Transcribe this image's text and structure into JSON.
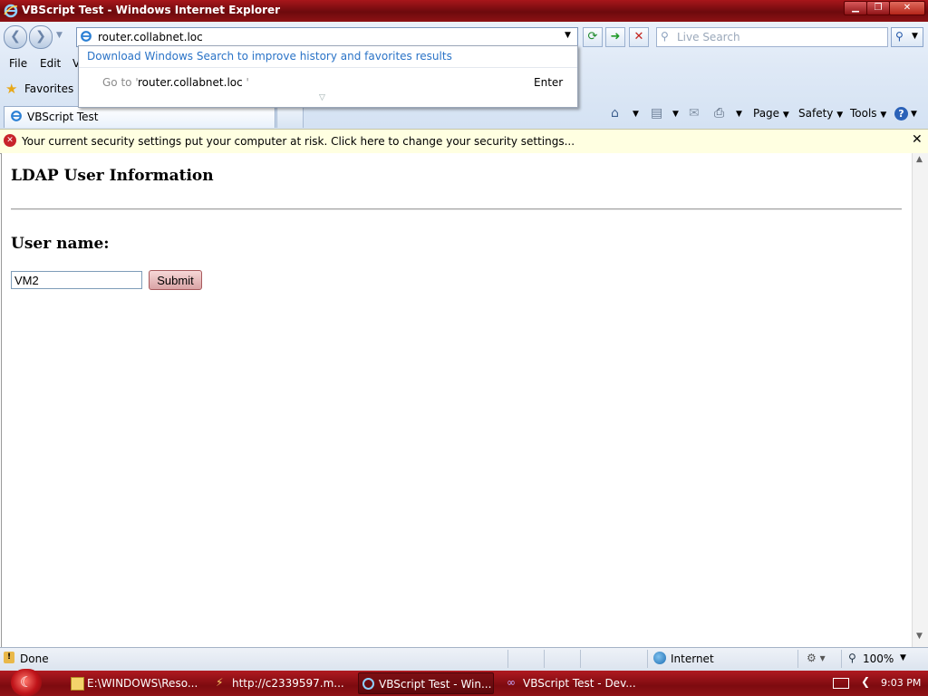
{
  "window": {
    "title": "VBScript Test - Windows Internet Explorer"
  },
  "address": {
    "url": "router.collabnet.loc"
  },
  "search": {
    "placeholder": "Live Search"
  },
  "menu": [
    "File",
    "Edit",
    "V"
  ],
  "favorites": {
    "label": "Favorites"
  },
  "autocomplete": {
    "link": "Download Windows Search to improve history and favorites results",
    "goto_prefix": "Go to ' ",
    "goto_url": "router.collabnet.loc",
    "goto_suffix": " '",
    "enter": "Enter"
  },
  "tab": {
    "label": "VBScript Test"
  },
  "command_bar": {
    "page": "Page",
    "safety": "Safety",
    "tools": "Tools"
  },
  "infobar": {
    "message": "Your current security settings put your computer at risk. Click here to change your security settings..."
  },
  "page": {
    "heading": "LDAP User Information",
    "user_label": "User name:",
    "username_value": "VM2",
    "submit_label": "Submit"
  },
  "status": {
    "text": "Done",
    "zone": "Internet",
    "zoom": "100%"
  },
  "taskbar": {
    "items": [
      {
        "label": "E:\\WINDOWS\\Reso..."
      },
      {
        "label": "http://c2339597.m..."
      },
      {
        "label": "VBScript Test - Win..."
      },
      {
        "label": "VBScript Test - Dev..."
      }
    ],
    "clock": "9:03 PM"
  }
}
